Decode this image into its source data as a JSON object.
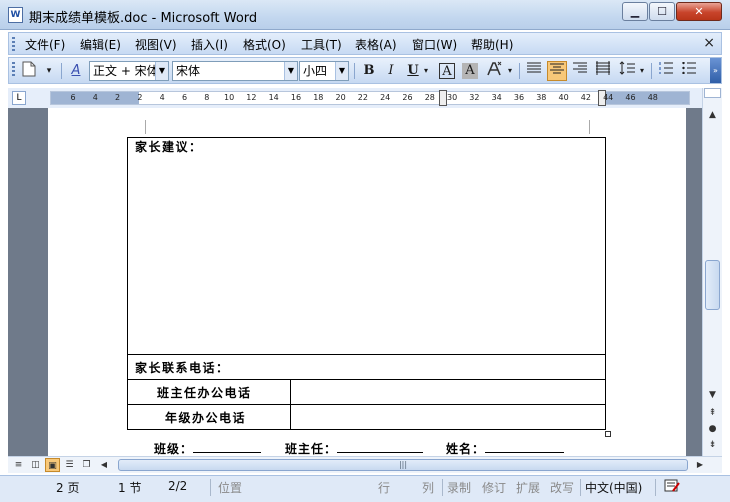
{
  "window": {
    "title": "期末成绩单模板.doc - Microsoft Word",
    "app_icon": "W",
    "min_icon": "▁",
    "max_icon": "☐",
    "close_icon": "✕"
  },
  "menu": {
    "items": [
      "文件(F)",
      "编辑(E)",
      "视图(V)",
      "插入(I)",
      "格式(O)",
      "工具(T)",
      "表格(A)",
      "窗口(W)",
      "帮助(H)"
    ],
    "close": "×"
  },
  "toolbar": {
    "style_value": "正文 + 宋体",
    "font_value": "宋体",
    "size_value": "小四",
    "bold": "B",
    "italic": "I",
    "underline": "U",
    "char_border": "A",
    "char_shading": "A",
    "styles_icon": "A"
  },
  "ruler": {
    "ticks": [
      "6",
      "4",
      "2",
      "2",
      "4",
      "6",
      "8",
      "10",
      "12",
      "14",
      "16",
      "18",
      "20",
      "22",
      "24",
      "26",
      "28",
      "30",
      "32",
      "34",
      "36",
      "38",
      "40",
      "42",
      "44",
      "46",
      "48"
    ],
    "corner": "L"
  },
  "document": {
    "parent_suggestion": "家长建议：",
    "parent_phone": "家长联系电话：",
    "homeroom_office_phone": "班主任办公电话",
    "grade_office_phone": "年级办公电话",
    "footer_class": "班级：",
    "footer_teacher": "班主任：",
    "footer_name": "姓名："
  },
  "statusbar": {
    "page": "2 页",
    "section": "1 节",
    "page_of": "2/2",
    "position": "位置",
    "line": "行",
    "column": "列",
    "record": "录制",
    "revision": "修订",
    "extend": "扩展",
    "overtype": "改写",
    "language": "中文(中国)"
  },
  "colors": {
    "accent_active": "#f8c879",
    "title_bar": "#c3d7ef",
    "doc_background": "#6f7a8a"
  }
}
